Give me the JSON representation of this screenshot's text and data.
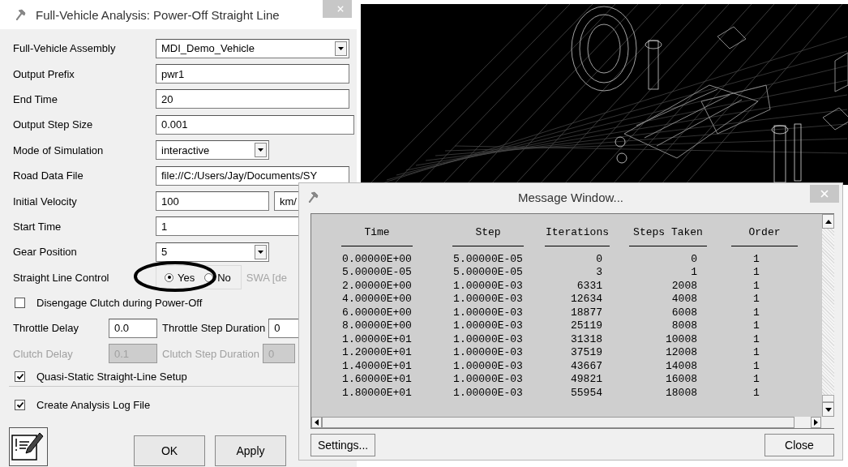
{
  "dialog": {
    "title": "Full-Vehicle Analysis: Power-Off Straight Line",
    "rows": [
      {
        "kind": "dropdown",
        "label": "Full-Vehicle Assembly",
        "value": "MDI_Demo_Vehicle"
      },
      {
        "kind": "text",
        "label": "Output Prefix",
        "value": "pwr1"
      },
      {
        "kind": "text",
        "label": "End Time",
        "value": "20"
      },
      {
        "kind": "text",
        "label": "Output Step Size",
        "value": "0.001"
      },
      {
        "kind": "dropdown",
        "label": "Mode of Simulation",
        "value": "interactive"
      },
      {
        "kind": "text",
        "label": "Road Data File",
        "value": "file://C:/Users/Jay/Documents/SY"
      },
      {
        "kind": "unit",
        "label": "Initial Velocity",
        "value": "100",
        "unit": "km/"
      },
      {
        "kind": "text",
        "label": "Start Time",
        "value": "1"
      },
      {
        "kind": "dropdown",
        "label": "Gear Position",
        "value": "5"
      },
      {
        "kind": "radio",
        "label": "Straight Line Control",
        "options": [
          {
            "label": "Yes",
            "selected": true
          },
          {
            "label": "No",
            "selected": false
          }
        ],
        "note": "SWA [de"
      },
      {
        "kind": "checkbox",
        "label": "Disengage Clutch during Power-Off",
        "checked": false
      },
      {
        "kind": "pair",
        "label": "Throttle Delay",
        "value": "0.0",
        "label_2": "Throttle Step Duration",
        "value_2": "0",
        "disabled": false
      },
      {
        "kind": "pair",
        "label": "Clutch Delay",
        "value": "0.1",
        "label_2": "Clutch Step Duration",
        "value_2": "0",
        "disabled": true
      },
      {
        "kind": "checkbox",
        "label": "Quasi-Static Straight-Line Setup",
        "checked": true
      },
      {
        "kind": "checkbox",
        "label": "Create Analysis Log File",
        "checked": true
      }
    ],
    "buttons": [
      "OK",
      "Apply"
    ]
  },
  "message_window": {
    "title": "Message Window...",
    "columns": [
      "Time",
      "Step",
      "Iterations",
      "Steps Taken",
      "Order"
    ],
    "rows": [
      [
        "0.00000E+00",
        "5.00000E-05",
        "0",
        "0",
        "1"
      ],
      [
        "5.00000E-05",
        "5.00000E-05",
        "3",
        "1",
        "1"
      ],
      [
        "2.00000E+00",
        "1.00000E-03",
        "6331",
        "2008",
        "1"
      ],
      [
        "4.00000E+00",
        "1.00000E-03",
        "12634",
        "4008",
        "1"
      ],
      [
        "6.00000E+00",
        "1.00000E-03",
        "18877",
        "6008",
        "1"
      ],
      [
        "8.00000E+00",
        "1.00000E-03",
        "25119",
        "8008",
        "1"
      ],
      [
        "1.00000E+01",
        "1.00000E-03",
        "31318",
        "10008",
        "1"
      ],
      [
        "1.20000E+01",
        "1.00000E-03",
        "37519",
        "12008",
        "1"
      ],
      [
        "1.40000E+01",
        "1.00000E-03",
        "43667",
        "14008",
        "1"
      ],
      [
        "1.60000E+01",
        "1.00000E-03",
        "49821",
        "16008",
        "1"
      ],
      [
        "1.80000E+01",
        "1.00000E-03",
        "55954",
        "18008",
        "1"
      ]
    ],
    "buttons": [
      "Settings...",
      "Close"
    ]
  }
}
